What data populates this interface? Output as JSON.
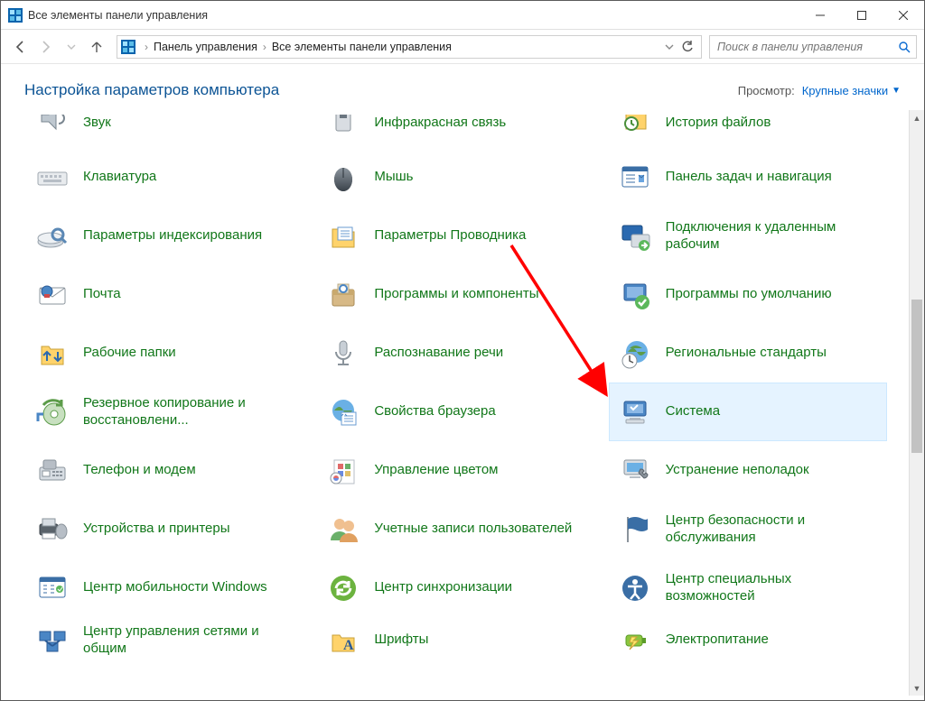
{
  "window": {
    "title": "Все элементы панели управления"
  },
  "breadcrumbs": {
    "a": "Панель управления",
    "b": "Все элементы панели управления"
  },
  "search": {
    "placeholder": "Поиск в панели управления"
  },
  "header": {
    "title": "Настройка параметров компьютера",
    "view_label": "Просмотр:",
    "view_value": "Крупные значки"
  },
  "items": {
    "r0c0": "Звук",
    "r0c1": "Инфракрасная связь",
    "r0c2": "История файлов",
    "r1c0": "Клавиатура",
    "r1c1": "Мышь",
    "r1c2": "Панель задач и навигация",
    "r2c0": "Параметры индексирования",
    "r2c1": "Параметры Проводника",
    "r2c2": "Подключения к удаленным рабочим",
    "r3c0": "Почта",
    "r3c1": "Программы и компоненты",
    "r3c2": "Программы по умолчанию",
    "r4c0": "Рабочие папки",
    "r4c1": "Распознавание речи",
    "r4c2": "Региональные стандарты",
    "r5c0": "Резервное копирование и восстановлени...",
    "r5c1": "Свойства браузера",
    "r5c2": "Система",
    "r6c0": "Телефон и модем",
    "r6c1": "Управление цветом",
    "r6c2": "Устранение неполадок",
    "r7c0": "Устройства и принтеры",
    "r7c1": "Учетные записи пользователей",
    "r7c2": "Центр безопасности и обслуживания",
    "r8c0": "Центр мобильности Windows",
    "r8c1": "Центр синхронизации",
    "r8c2": "Центр специальных возможностей",
    "r9c0": "Центр управления сетями и общим",
    "r9c1": "Шрифты",
    "r9c2": "Электропитание"
  }
}
